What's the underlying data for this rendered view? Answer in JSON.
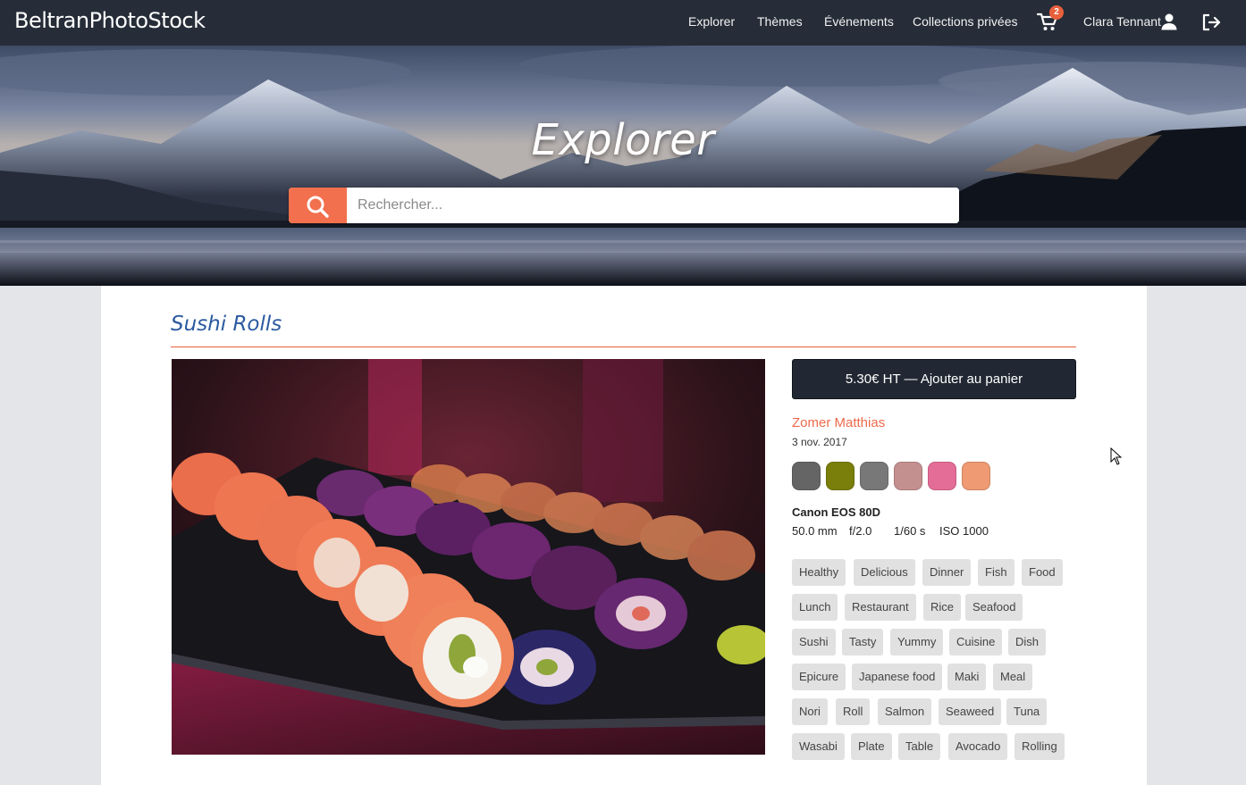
{
  "nav": {
    "brand": "BeltranPhotoStock",
    "links": [
      "Explorer",
      "Thèmes",
      "Événements",
      "Collections privées"
    ],
    "cart_count": "2",
    "user_name": "Clara Tennant"
  },
  "hero": {
    "title": "Explorer",
    "search_placeholder": "Rechercher..."
  },
  "photo": {
    "title": "Sushi Rolls",
    "buy_label": "5.30€ HT — Ajouter au panier",
    "author": "Zomer Matthias",
    "date": "3 nov. 2017",
    "colors": [
      "#656565",
      "#7a7f0b",
      "#787878",
      "#c4908f",
      "#e46d97",
      "#ef9a73"
    ],
    "camera": "Canon EOS 80D",
    "exif": {
      "focal": "50.0 mm",
      "aperture": "f/2.0",
      "shutter": "1/60 s",
      "iso": "ISO 1000"
    },
    "tags": [
      [
        "Healthy",
        "Delicious",
        "Dinner",
        "Fish",
        "Food"
      ],
      [
        "Lunch",
        "Restaurant",
        "Rice",
        "Seafood"
      ],
      [
        "Sushi",
        "Tasty",
        "Yummy",
        "Cuisine",
        "Dish"
      ],
      [
        "Epicure",
        "Japanese food",
        "Maki",
        "Meal"
      ],
      [
        "Nori",
        "Roll",
        "Salmon",
        "Seaweed",
        "Tuna"
      ],
      [
        "Wasabi",
        "Plate",
        "Table",
        "Avocado",
        "Rolling"
      ]
    ]
  },
  "icons": {
    "search": "search-icon",
    "cart": "cart-icon",
    "user": "user-icon",
    "logout": "logout-icon"
  },
  "colors": {
    "nav_bg": "#262d38",
    "accent": "#f2704d",
    "title_blue": "#2c5aa0",
    "author_orange": "#ee6a4b"
  }
}
